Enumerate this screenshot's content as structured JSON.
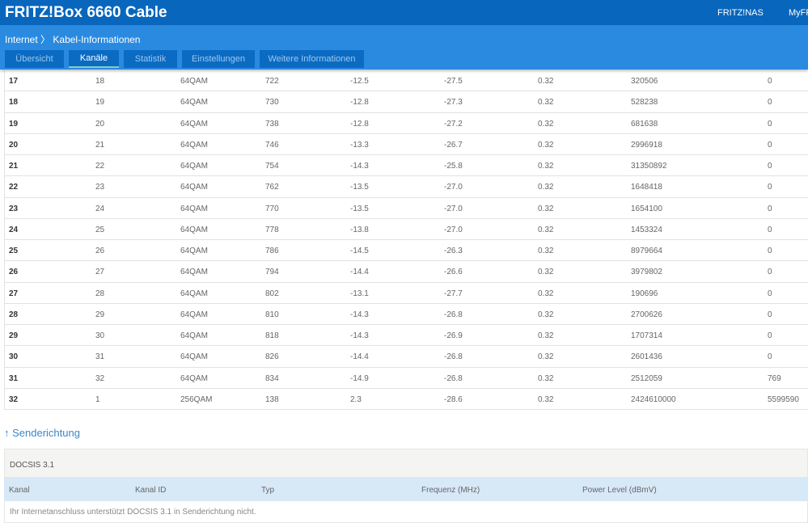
{
  "header": {
    "title": "FRITZ!Box 6660 Cable",
    "links": [
      "FRITZ!NAS",
      "MyFRITZ!"
    ]
  },
  "breadcrumb": {
    "parent": "Internet",
    "separator": "〉",
    "current": "Kabel-Informationen"
  },
  "tabs": [
    {
      "label": "Übersicht",
      "active": false
    },
    {
      "label": "Kanäle",
      "active": true
    },
    {
      "label": "Statistik",
      "active": false
    },
    {
      "label": "Einstellungen",
      "active": false
    },
    {
      "label": "Weitere Informationen",
      "active": false
    }
  ],
  "downstream_rows": [
    [
      "17",
      "18",
      "64QAM",
      "722",
      "-12.5",
      "-27.5",
      "0.32",
      "320506",
      "0"
    ],
    [
      "18",
      "19",
      "64QAM",
      "730",
      "-12.8",
      "-27.3",
      "0.32",
      "528238",
      "0"
    ],
    [
      "19",
      "20",
      "64QAM",
      "738",
      "-12.8",
      "-27.2",
      "0.32",
      "681638",
      "0"
    ],
    [
      "20",
      "21",
      "64QAM",
      "746",
      "-13.3",
      "-26.7",
      "0.32",
      "2996918",
      "0"
    ],
    [
      "21",
      "22",
      "64QAM",
      "754",
      "-14.3",
      "-25.8",
      "0.32",
      "31350892",
      "0"
    ],
    [
      "22",
      "23",
      "64QAM",
      "762",
      "-13.5",
      "-27.0",
      "0.32",
      "1648418",
      "0"
    ],
    [
      "23",
      "24",
      "64QAM",
      "770",
      "-13.5",
      "-27.0",
      "0.32",
      "1654100",
      "0"
    ],
    [
      "24",
      "25",
      "64QAM",
      "778",
      "-13.8",
      "-27.0",
      "0.32",
      "1453324",
      "0"
    ],
    [
      "25",
      "26",
      "64QAM",
      "786",
      "-14.5",
      "-26.3",
      "0.32",
      "8979664",
      "0"
    ],
    [
      "26",
      "27",
      "64QAM",
      "794",
      "-14.4",
      "-26.6",
      "0.32",
      "3979802",
      "0"
    ],
    [
      "27",
      "28",
      "64QAM",
      "802",
      "-13.1",
      "-27.7",
      "0.32",
      "190696",
      "0"
    ],
    [
      "28",
      "29",
      "64QAM",
      "810",
      "-14.3",
      "-26.8",
      "0.32",
      "2700626",
      "0"
    ],
    [
      "29",
      "30",
      "64QAM",
      "818",
      "-14.3",
      "-26.9",
      "0.32",
      "1707314",
      "0"
    ],
    [
      "30",
      "31",
      "64QAM",
      "826",
      "-14.4",
      "-26.8",
      "0.32",
      "2601436",
      "0"
    ],
    [
      "31",
      "32",
      "64QAM",
      "834",
      "-14.9",
      "-26.8",
      "0.32",
      "2512059",
      "769"
    ],
    [
      "32",
      "1",
      "256QAM",
      "138",
      "2.3",
      "-28.6",
      "0.32",
      "2424610000",
      "5599590"
    ]
  ],
  "upstream": {
    "title": "↑ Senderichtung",
    "docsis_label": "DOCSIS 3.1",
    "columns": [
      "Kanal",
      "Kanal ID",
      "Typ",
      "Frequenz (MHz)",
      "Power Level (dBmV)"
    ],
    "message": "Ihr Internetanschluss unterstützt DOCSIS 3.1 in Senderichtung nicht."
  },
  "colors": {
    "header": "#0866bd",
    "subheader": "#2a8ae0",
    "tab": "#0b6bc2",
    "link": "#3a87c8"
  }
}
